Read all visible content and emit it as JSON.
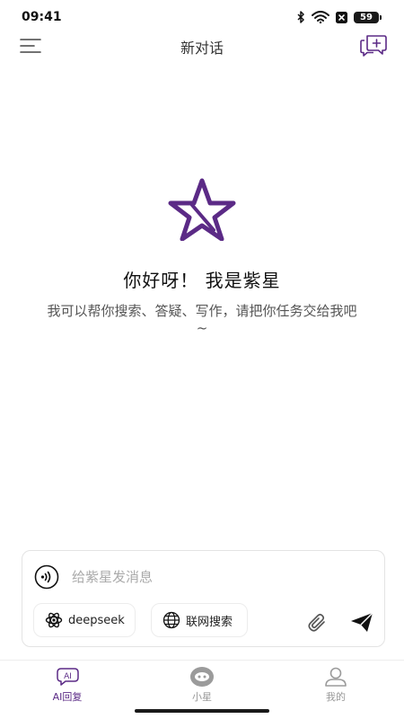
{
  "status_bar": {
    "time": "09:41",
    "battery_level": "59",
    "icons": [
      "bluetooth-icon",
      "wifi-icon",
      "notification-x-icon",
      "battery-icon"
    ]
  },
  "header": {
    "title": "新对话",
    "left_icon": "menu-icon",
    "right_icon": "new-chat-icon"
  },
  "welcome": {
    "title": "你好呀！ 我是紫星",
    "description": "我可以帮你搜索、答疑、写作，请把你任务交给我吧~",
    "logo": "star-logo-icon"
  },
  "composer": {
    "placeholder": "给紫星发消息",
    "value": "",
    "chips": [
      {
        "label": "deepseek",
        "icon": "deepseek-icon"
      },
      {
        "label": "联网搜索",
        "icon": "globe-icon"
      }
    ]
  },
  "tabs": [
    {
      "label": "AI回复",
      "icon": "ai-reply-icon",
      "active": true
    },
    {
      "label": "小星",
      "icon": "xiaoxing-icon",
      "active": false
    },
    {
      "label": "我的",
      "icon": "profile-icon",
      "active": false
    }
  ],
  "colors": {
    "brand_purple": "#5b2a86",
    "text_primary": "#111111",
    "text_secondary": "#555555",
    "placeholder": "#aaaaaa",
    "tab_inactive": "#999999"
  }
}
